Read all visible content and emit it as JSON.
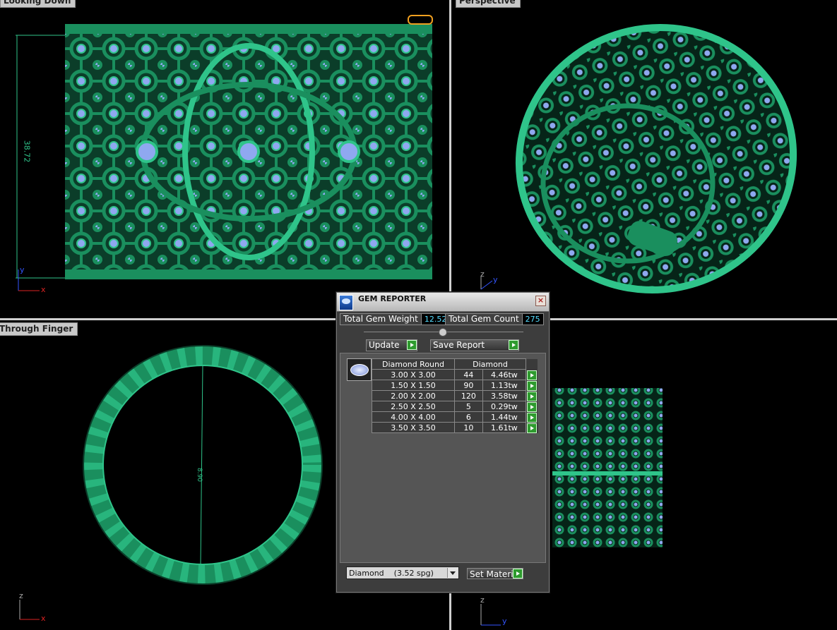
{
  "viewports": {
    "top_left": {
      "label": "Looking Down",
      "dimension": "38.72"
    },
    "top_right": {
      "label": "Perspective"
    },
    "bottom_left": {
      "label": "Through Finger",
      "dimension": "8.90"
    },
    "bottom_right": {
      "label": ""
    }
  },
  "axes": {
    "x": "x",
    "y": "y",
    "z": "z"
  },
  "gem_reporter": {
    "title": "GEM REPORTER",
    "close_glyph": "×",
    "total_weight_label": "Total Gem Weight",
    "total_weight_value": "12.52",
    "total_count_label": "Total Gem Count",
    "total_count_value": "275",
    "update_label": "Update",
    "save_report_label": "Save Report",
    "table": {
      "header_shape": "Diamond Round",
      "header_material": "Diamond",
      "rows": [
        {
          "size": "3.00 X 3.00",
          "count": "44",
          "weight": "4.46tw"
        },
        {
          "size": "1.50 X 1.50",
          "count": "90",
          "weight": "1.13tw"
        },
        {
          "size": "2.00 X 2.00",
          "count": "120",
          "weight": "3.58tw"
        },
        {
          "size": "2.50 X 2.50",
          "count": "5",
          "weight": "0.29tw"
        },
        {
          "size": "4.00 X 4.00",
          "count": "6",
          "weight": "1.44tw"
        },
        {
          "size": "3.50 X 3.50",
          "count": "10",
          "weight": "1.61tw"
        }
      ]
    },
    "material_select": "Diamond    (3.52 spg)",
    "set_material_label": "Set Material"
  },
  "colors": {
    "metal": "#1a8f5e",
    "metal_light": "#2fc48a",
    "gem": "#8fa8f0",
    "background": "#000000",
    "value_text": "#55ddff"
  }
}
